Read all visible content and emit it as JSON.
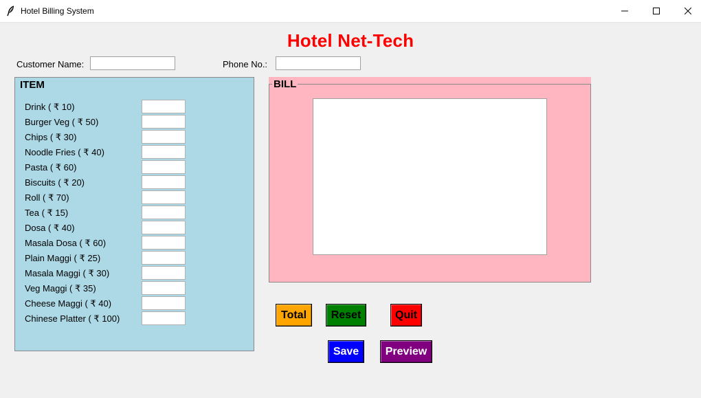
{
  "window": {
    "title": "Hotel Billing System",
    "icon": "feather-icon",
    "controls": [
      "minimize-icon",
      "maximize-icon",
      "close-icon"
    ]
  },
  "header": {
    "title": "Hotel Net-Tech",
    "color": "#ff0000"
  },
  "customer": {
    "name_label": "Customer Name:",
    "name_value": "",
    "phone_label": "Phone No.:",
    "phone_value": ""
  },
  "item_frame": {
    "label": "ITEM",
    "background": "#add8e6",
    "items": [
      {
        "label": "Drink ( ₹ 10)",
        "qty": ""
      },
      {
        "label": "Burger Veg ( ₹ 50)",
        "qty": ""
      },
      {
        "label": "Chips ( ₹ 30)",
        "qty": ""
      },
      {
        "label": "Noodle Fries ( ₹ 40)",
        "qty": ""
      },
      {
        "label": "Pasta ( ₹ 60)",
        "qty": ""
      },
      {
        "label": "Biscuits ( ₹ 20)",
        "qty": ""
      },
      {
        "label": "Roll ( ₹ 70)",
        "qty": ""
      },
      {
        "label": "Tea ( ₹ 15)",
        "qty": ""
      },
      {
        "label": "Dosa ( ₹ 40)",
        "qty": ""
      },
      {
        "label": "Masala Dosa ( ₹ 60)",
        "qty": ""
      },
      {
        "label": "Plain Maggi ( ₹ 25)",
        "qty": ""
      },
      {
        "label": "Masala Maggi ( ₹ 30)",
        "qty": ""
      },
      {
        "label": "Veg Maggi ( ₹ 35)",
        "qty": ""
      },
      {
        "label": "Cheese Maggi ( ₹ 40)",
        "qty": ""
      },
      {
        "label": "Chinese Platter ( ₹ 100)",
        "qty": ""
      }
    ]
  },
  "bill_frame": {
    "label": "BILL",
    "background": "#ffb6c1",
    "text": ""
  },
  "buttons": {
    "total": {
      "label": "Total",
      "bg": "#ffa500",
      "fg": "#000000"
    },
    "reset": {
      "label": "Reset",
      "bg": "#008000",
      "fg": "#000000"
    },
    "quit": {
      "label": "Quit",
      "bg": "#ff0000",
      "fg": "#000000"
    },
    "save": {
      "label": "Save",
      "bg": "#0000ff",
      "fg": "#ffffff"
    },
    "preview": {
      "label": "Preview",
      "bg": "#800080",
      "fg": "#ffffff"
    }
  }
}
